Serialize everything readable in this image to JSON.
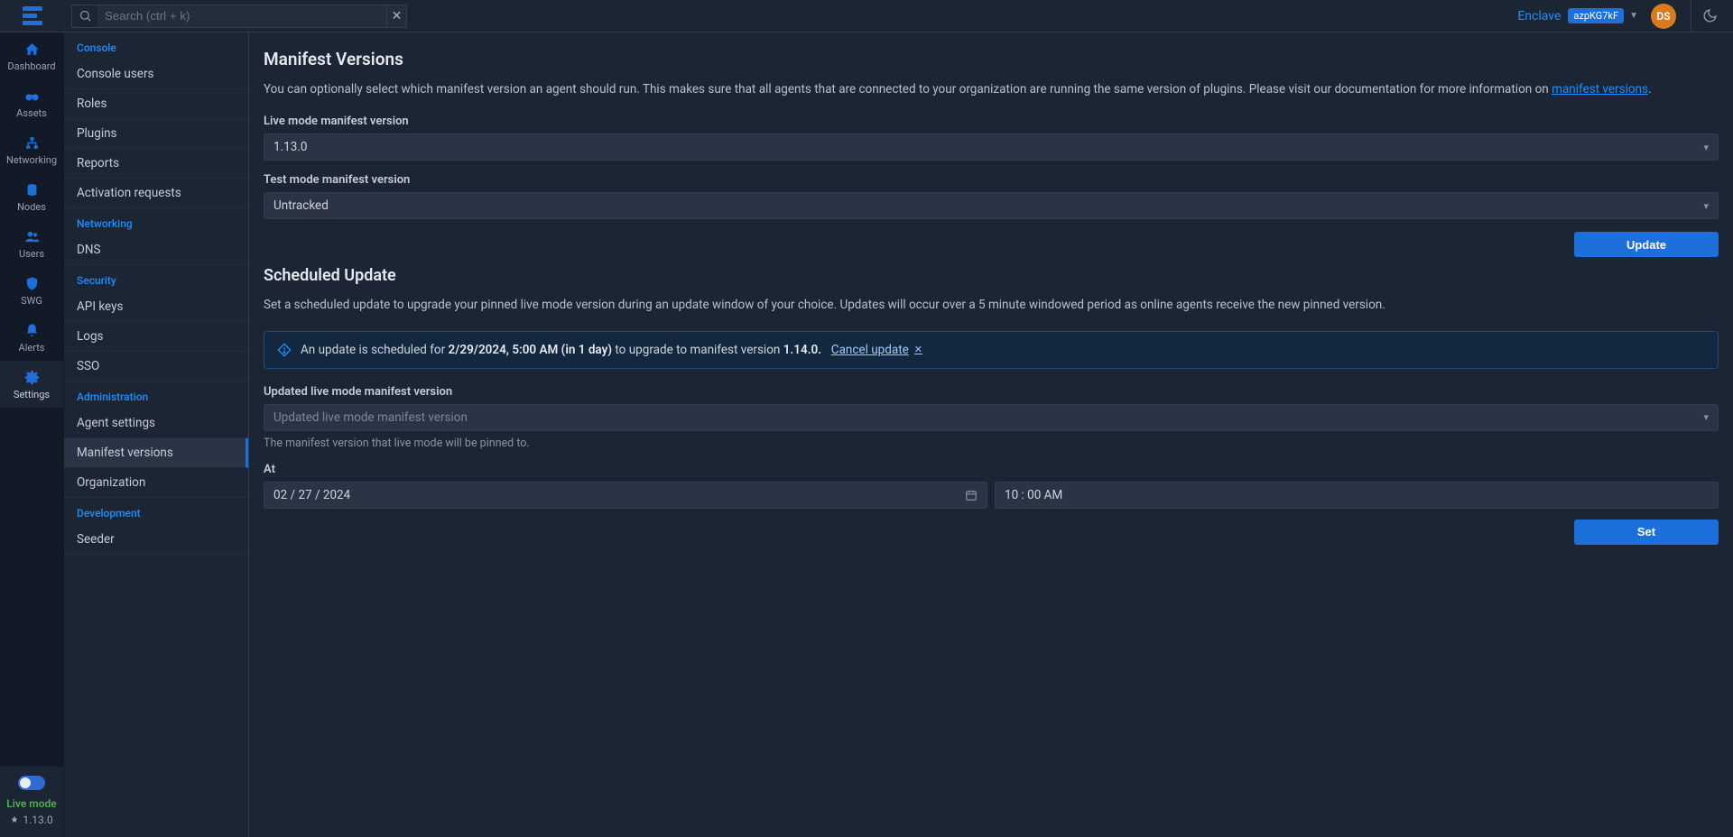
{
  "search": {
    "placeholder": "Search (ctrl + k)"
  },
  "header": {
    "org_label": "Enclave",
    "org_id": "azpKG7kF",
    "avatar": "DS"
  },
  "rail": {
    "items": [
      {
        "label": "Dashboard"
      },
      {
        "label": "Assets"
      },
      {
        "label": "Networking"
      },
      {
        "label": "Nodes"
      },
      {
        "label": "Users"
      },
      {
        "label": "SWG"
      },
      {
        "label": "Alerts"
      },
      {
        "label": "Settings"
      }
    ],
    "footer": {
      "mode": "Live mode",
      "version": "1.13.0"
    }
  },
  "sidebar": {
    "groups": [
      {
        "header": "Console",
        "items": [
          "Console users",
          "Roles",
          "Plugins",
          "Reports",
          "Activation requests"
        ]
      },
      {
        "header": "Networking",
        "items": [
          "DNS"
        ]
      },
      {
        "header": "Security",
        "items": [
          "API keys",
          "Logs",
          "SSO"
        ]
      },
      {
        "header": "Administration",
        "items": [
          "Agent settings",
          "Manifest versions",
          "Organization"
        ]
      },
      {
        "header": "Development",
        "items": [
          "Seeder"
        ]
      }
    ],
    "active": "Manifest versions"
  },
  "main": {
    "title": "Manifest Versions",
    "intro_pre": "You can optionally select which manifest version an agent should run. This makes sure that all agents that are connected to your organization are running the same version of plugins. Please visit our documentation for more information on ",
    "intro_link": "manifest versions",
    "intro_post": ".",
    "live_label": "Live mode manifest version",
    "live_value": "1.13.0",
    "test_label": "Test mode manifest version",
    "test_value": "Untracked",
    "update_btn": "Update",
    "sched_title": "Scheduled Update",
    "sched_intro": "Set a scheduled update to upgrade your pinned live mode version during an update window of your choice. Updates will occur over a 5 minute windowed period as online agents receive the new pinned version.",
    "alert": {
      "pre": "An update is scheduled for ",
      "when": "2/29/2024, 5:00 AM (in 1 day)",
      "mid": " to upgrade to manifest version ",
      "ver": "1.14.0.",
      "cancel": "Cancel update "
    },
    "updated_label": "Updated live mode manifest version",
    "updated_placeholder": "Updated live mode manifest version",
    "updated_hint": "The manifest version that live mode will be pinned to.",
    "at_label": "At",
    "date_value": "02 / 27 / 2024",
    "time_value": "10 : 00   AM",
    "set_btn": "Set"
  }
}
